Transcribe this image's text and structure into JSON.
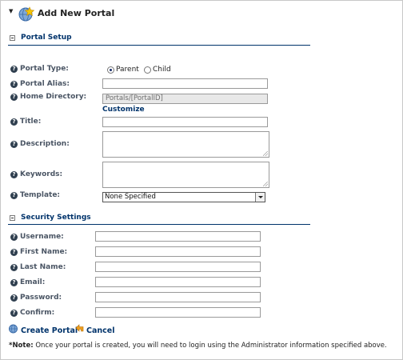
{
  "header": {
    "title": "Add New Portal"
  },
  "portal_setup": {
    "section_title": "Portal Setup",
    "portal_type": {
      "label": "Portal Type:",
      "options": [
        "Parent",
        "Child"
      ],
      "selected": "Parent"
    },
    "portal_alias": {
      "label": "Portal Alias:",
      "value": ""
    },
    "home_directory": {
      "label": "Home Directory:",
      "value": "Portals/[PortalID]",
      "customize_link": "Customize"
    },
    "title": {
      "label": "Title:",
      "value": ""
    },
    "description": {
      "label": "Description:",
      "value": ""
    },
    "keywords": {
      "label": "Keywords:",
      "value": ""
    },
    "template": {
      "label": "Template:",
      "selected": "None Specified"
    }
  },
  "security_settings": {
    "section_title": "Security Settings",
    "fields": [
      {
        "label": "Username:",
        "value": ""
      },
      {
        "label": "First Name:",
        "value": ""
      },
      {
        "label": "Last Name:",
        "value": ""
      },
      {
        "label": "Email:",
        "value": ""
      },
      {
        "label": "Password:",
        "value": ""
      },
      {
        "label": "Confirm:",
        "value": ""
      }
    ]
  },
  "actions": {
    "create_label": "Create Portal",
    "cancel_label": "Cancel"
  },
  "note": {
    "prefix": "*Note:",
    "text": "Once your portal is created, you will need to login using the Administrator information specified above."
  },
  "icons": {
    "header": "portal-star-icon",
    "help": "help-icon",
    "create": "create-portal-icon",
    "cancel": "cancel-arrow-icon"
  }
}
